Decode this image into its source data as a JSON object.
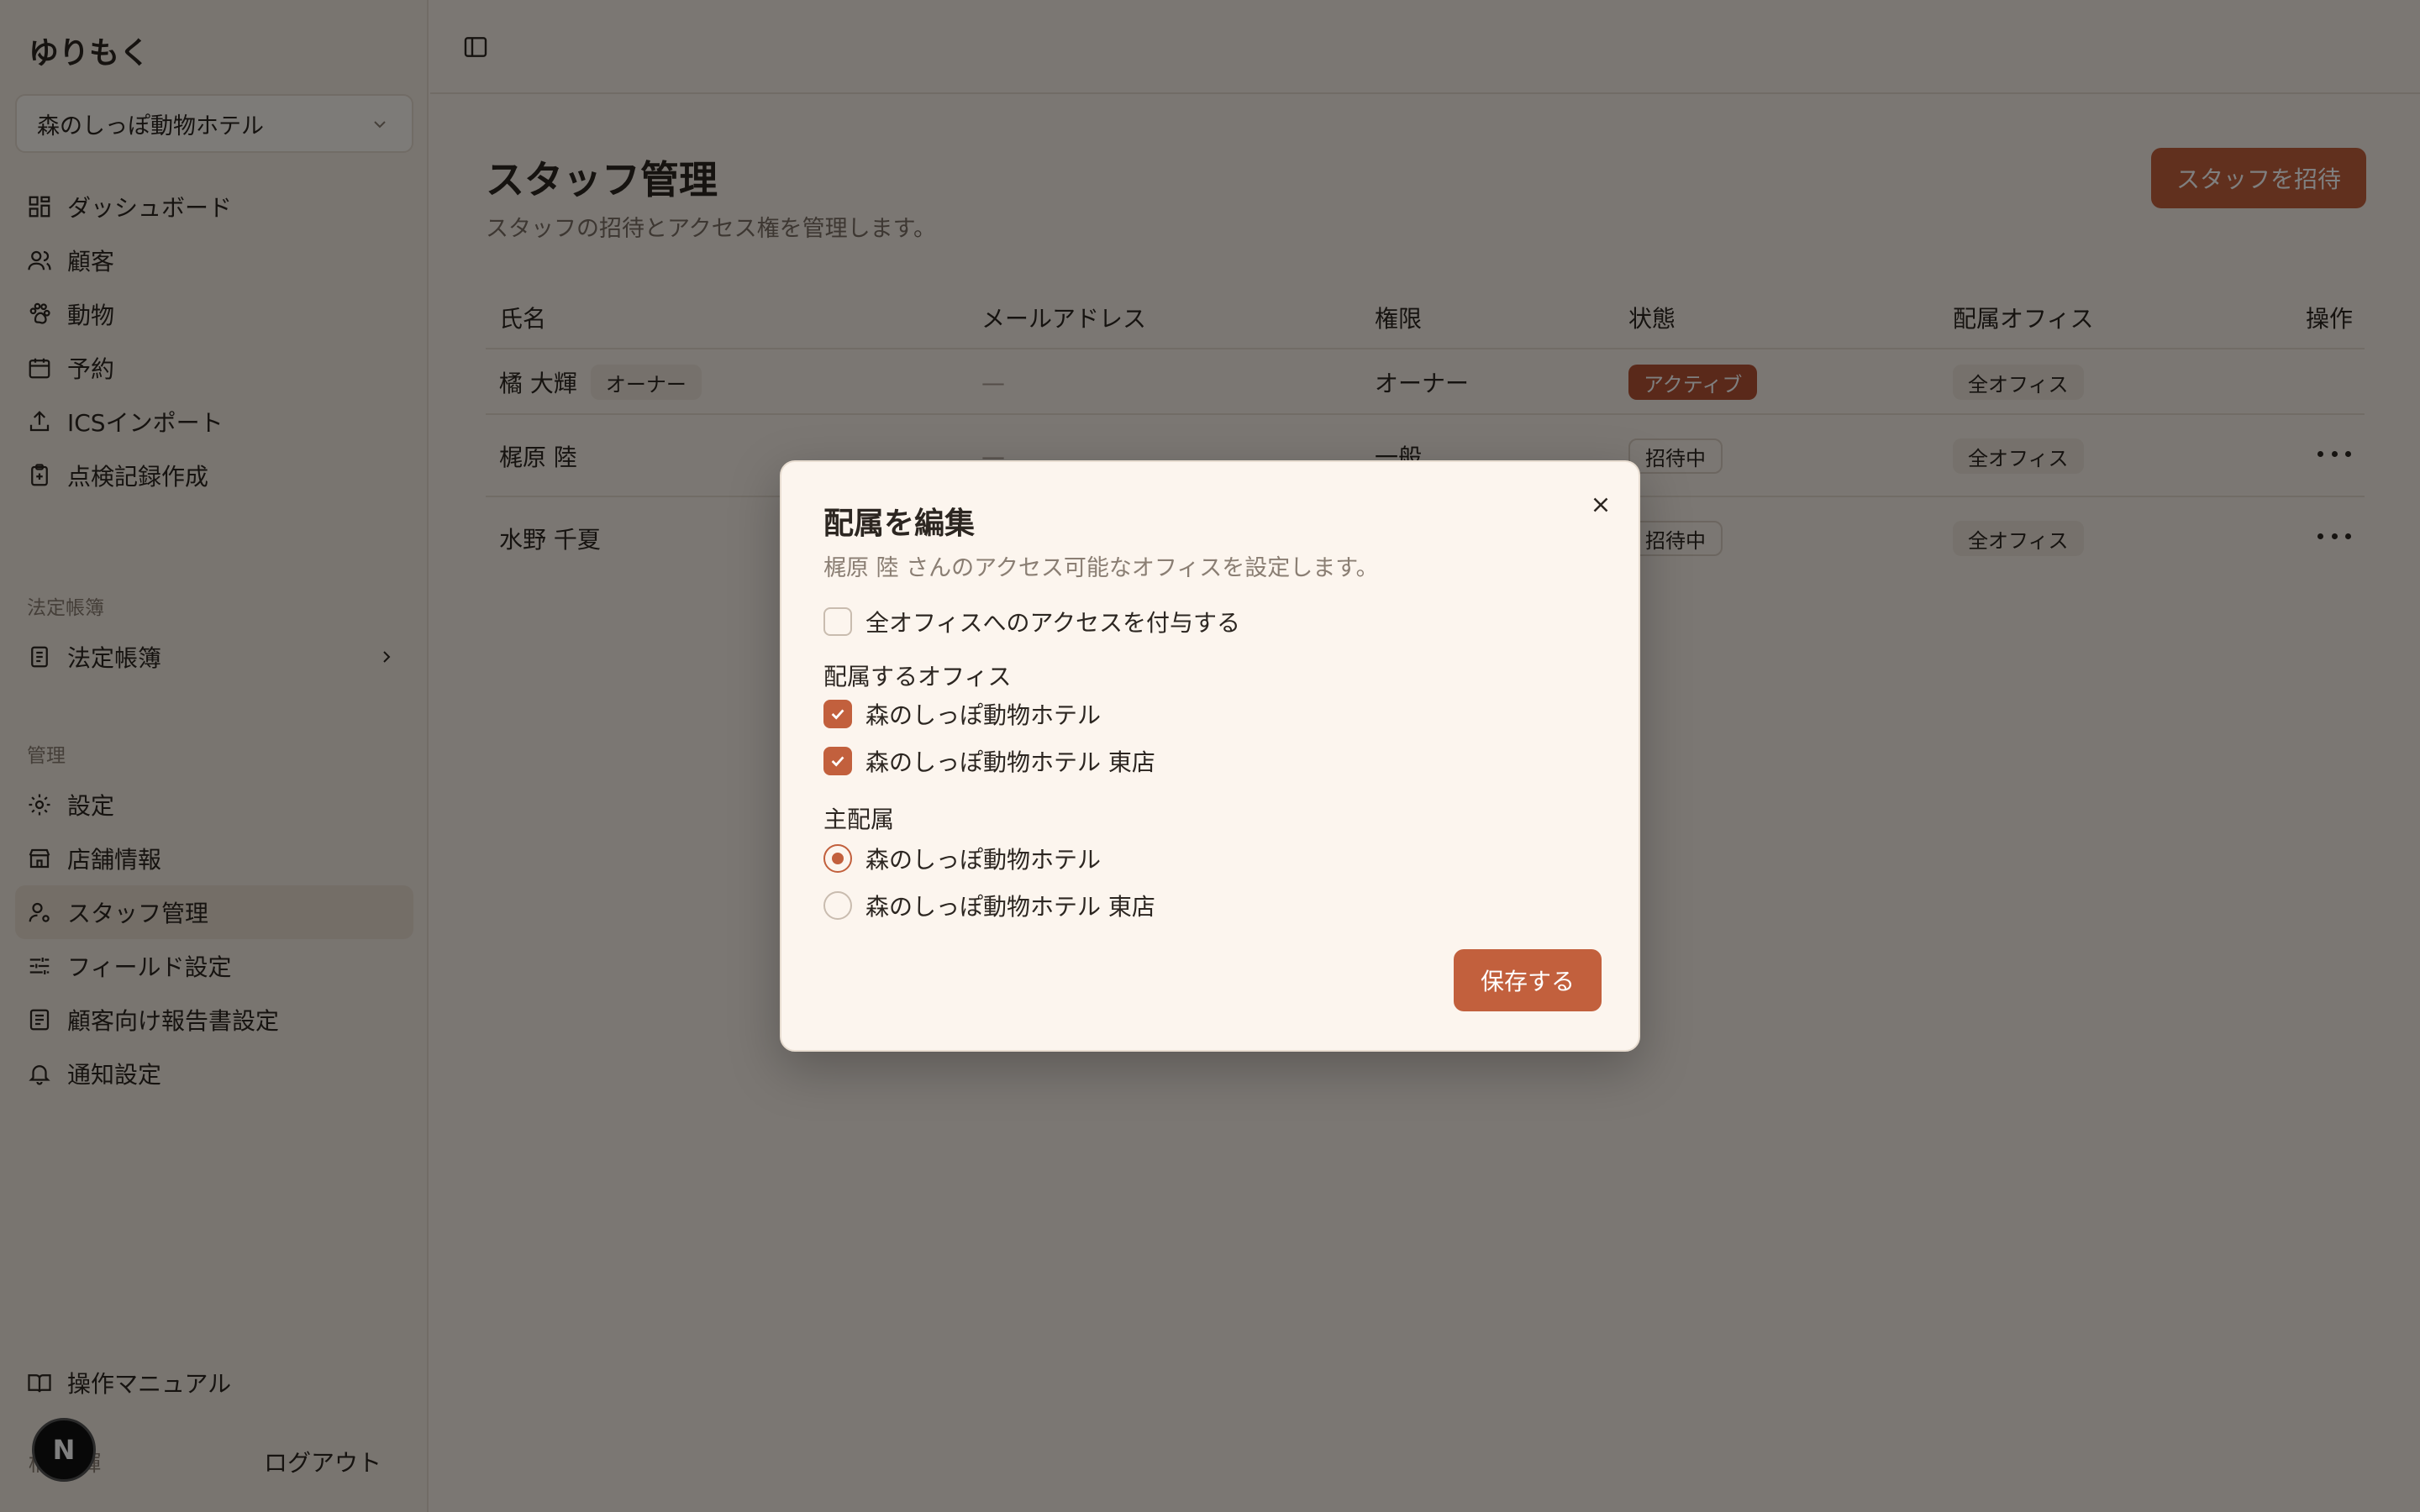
{
  "app": {
    "brand": "ゆりもく"
  },
  "sidebar": {
    "office_selector": "森のしっぽ動物ホテル",
    "main_items": [
      {
        "label": "ダッシュボード",
        "icon": "dashboard-icon"
      },
      {
        "label": "顧客",
        "icon": "users-icon"
      },
      {
        "label": "動物",
        "icon": "paw-icon"
      },
      {
        "label": "予約",
        "icon": "calendar-icon"
      },
      {
        "label": "ICSインポート",
        "icon": "upload-icon"
      },
      {
        "label": "点検記録作成",
        "icon": "clipboard-icon"
      }
    ],
    "legal_section": "法定帳簿",
    "legal_items": [
      {
        "label": "法定帳簿",
        "icon": "ledger-icon"
      }
    ],
    "admin_section": "管理",
    "admin_items": [
      {
        "label": "設定",
        "icon": "gear-icon"
      },
      {
        "label": "店舗情報",
        "icon": "store-icon"
      },
      {
        "label": "スタッフ管理",
        "icon": "user-cog-icon",
        "active": true
      },
      {
        "label": "フィールド設定",
        "icon": "sliders-icon"
      },
      {
        "label": "顧客向け報告書設定",
        "icon": "report-icon"
      },
      {
        "label": "通知設定",
        "icon": "bell-icon"
      }
    ],
    "manual": "操作マニュアル",
    "user_label": "橘 大輝",
    "avatar_letter": "N",
    "logout": "ログアウト"
  },
  "main": {
    "title": "スタッフ管理",
    "subtitle": "スタッフの招待とアクセス権を管理します。",
    "invite_button": "スタッフを招待",
    "table": {
      "headers": {
        "name": "氏名",
        "email": "メールアドレス",
        "role": "権限",
        "status": "状態",
        "office": "配属オフィス",
        "actions": "操作"
      },
      "rows": [
        {
          "name": "橘 大輝",
          "tag": "オーナー",
          "email": "—",
          "role": "オーナー",
          "status": "アクティブ",
          "office": "全オフィス"
        },
        {
          "name": "梶原 陸",
          "email": "—",
          "role": "一般",
          "status": "招待中",
          "office": "全オフィス"
        },
        {
          "name": "水野 千夏",
          "email": "",
          "role": "",
          "status": "招待中",
          "office": "全オフィス"
        }
      ]
    }
  },
  "dialog": {
    "title": "配属を編集",
    "description": "梶原 陸 さんのアクセス可能なオフィスを設定します。",
    "all_access_label": "全オフィスへのアクセスを付与する",
    "all_access_checked": false,
    "offices_label": "配属するオフィス",
    "offices": [
      {
        "label": "森のしっぽ動物ホテル",
        "checked": true
      },
      {
        "label": "森のしっぽ動物ホテル 東店",
        "checked": true
      }
    ],
    "primary_label": "主配属",
    "primary_options": [
      {
        "label": "森のしっぽ動物ホテル",
        "selected": true
      },
      {
        "label": "森のしっぽ動物ホテル 東店",
        "selected": false
      }
    ],
    "save_button": "保存する"
  },
  "colors": {
    "accent": "#c2603d",
    "background": "#f7efe6",
    "sidebar": "#f3ebe1",
    "overlay": "rgba(0,0,0,0.5)"
  }
}
